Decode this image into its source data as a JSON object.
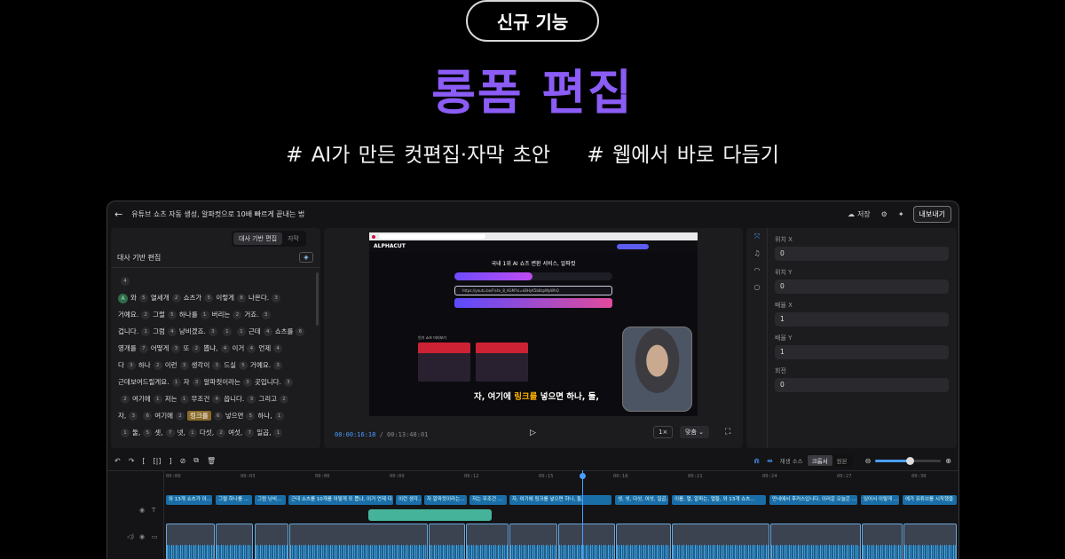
{
  "hero": {
    "badge": "신규 기능",
    "title": "롱폼 편집",
    "tag1": "# AI가 만든 컷편집·자막 초안",
    "tag2": "# 웹에서 바로 다듬기"
  },
  "topbar": {
    "back_icon": "arrow-left-icon",
    "title": "유튜브 쇼츠 자동 생성, 알파컷으로 10배 빠르게 끝내는 법",
    "save_label": "저장",
    "export_label": "내보내기"
  },
  "left_panel": {
    "tabs": [
      "대사 기반 편집",
      "자막"
    ],
    "heading": "대사 기반 편집",
    "speaker": "A",
    "lines": [
      [
        [
          "와",
          "5"
        ],
        [
          "열세개",
          "2"
        ],
        [
          "쇼츠가",
          "5"
        ],
        [
          "이렇게",
          "8"
        ],
        [
          "나온다.",
          "3"
        ]
      ],
      [
        [
          "거예요.",
          "2"
        ],
        [
          "그럴",
          "5"
        ],
        [
          "하나를",
          "1"
        ],
        [
          "버리는",
          "2"
        ],
        [
          "거죠.",
          "3"
        ]
      ],
      [
        [
          "겁니다.",
          "1"
        ],
        [
          "그럼",
          "4"
        ],
        [
          "낭비겠죠.",
          "3"
        ],
        [
          "1",
          "1"
        ],
        [
          "근데",
          "4"
        ],
        [
          "쇼츠를",
          "6"
        ]
      ],
      [
        [
          "영개를",
          "7"
        ],
        [
          "어떻게",
          "3"
        ],
        [
          "또",
          "2"
        ],
        [
          "뽑냐,",
          "4"
        ],
        [
          "이거",
          "4"
        ],
        [
          "언제",
          "4"
        ]
      ],
      [
        [
          "다",
          "3"
        ],
        [
          "하나",
          "2"
        ],
        [
          "이런",
          "3"
        ],
        [
          "생각이",
          "3"
        ],
        [
          "드실",
          "5"
        ],
        [
          "거예요.",
          "3"
        ]
      ],
      [
        [
          "근데",
          "보여드릴게요.",
          "1"
        ],
        [
          "자",
          "3"
        ],
        [
          "알파컷이라는",
          "3"
        ],
        [
          "곳입니다.",
          "3"
        ]
      ],
      [
        [
          "2",
          "여기에",
          "1"
        ],
        [
          "저는",
          "1"
        ],
        [
          "무조건",
          "4"
        ],
        [
          "씁니다.",
          "3"
        ],
        [
          "그리고",
          "2"
        ]
      ],
      [
        [
          "자,",
          "3",
          "6"
        ],
        [
          "여기에",
          "2"
        ],
        [
          "링크를",
          "6"
        ],
        [
          "넣으면",
          "5"
        ],
        [
          "하나,",
          "1"
        ]
      ],
      [
        [
          "1",
          "둘,",
          "5"
        ],
        [
          "셋,",
          "7"
        ],
        [
          "넷,",
          "1"
        ],
        [
          "다섯,",
          "2"
        ],
        [
          "여섯,",
          "7"
        ],
        [
          "일곱,",
          "1"
        ]
      ]
    ],
    "highlight_word": "링크를"
  },
  "preview": {
    "site_name": "ALPHACUT",
    "headline": "국내 1위 AI 쇼츠 변환 서비스, 알파컷",
    "url_text": "https://youtu.be/Fn4n_8_AGM?si=kBHyK5b8zpMpWhQ",
    "section_label": "인기 쇼츠 미리보기",
    "subtitle_pre": "자, 여기에 ",
    "subtitle_keyword": "링크를",
    "subtitle_post": " 넣으면 하나, 둘,",
    "current_time": "00:00:16:18",
    "separator": "/",
    "total_time": "00:13:48:01",
    "speed": "1×",
    "fit": "맞춤"
  },
  "properties": {
    "fields": [
      {
        "label": "위치 X",
        "value": "0"
      },
      {
        "label": "위치 Y",
        "value": "0"
      },
      {
        "label": "배율 X",
        "value": "1"
      },
      {
        "label": "배율 Y",
        "value": "1"
      },
      {
        "label": "회전",
        "value": "0"
      }
    ]
  },
  "toolbar": {
    "snap_label": "재생 소스",
    "source_options": [
      "크롭서",
      "원본"
    ],
    "zoom_level": 0.52
  },
  "timeline": {
    "ticks": [
      "00:00",
      "00:03",
      "00:06",
      "00:09",
      "00:12",
      "00:15",
      "00:18",
      "00:21",
      "00:24",
      "00:27",
      "00:30"
    ],
    "subtitles": [
      "와 13개 쇼츠가 이...",
      "그럴 하나를 ...",
      "그럼 낭비...",
      "근데 쇼츠를 10개를 어떻게 또 뽑냐, 이거 언제 다 ...",
      "이런 생각...",
      "자 알파컷이라는...",
      "저는 무조건 ...",
      "자, 여기에 링크를 넣으면 하나, 둘,",
      "셋, 넷, 다섯, 여섯, 일곱...",
      "이를, 열, 알파는, 열둘, 와 13개 쇼츠...",
      "만네에서 후커스입니다. 이러운 오늘은 ...",
      "있어서 이렇게 ...",
      "예가 유튜브를 시작했을"
    ]
  }
}
